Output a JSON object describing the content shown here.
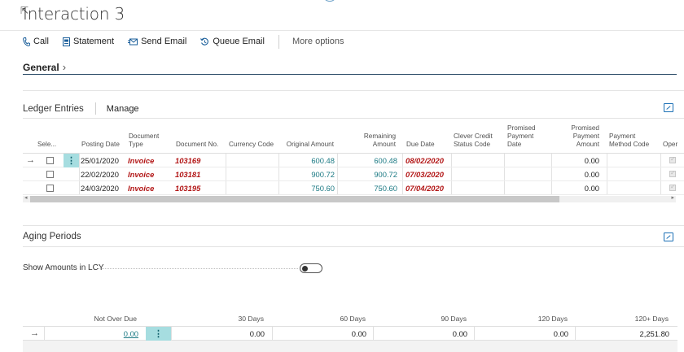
{
  "page": {
    "title": "Interaction 3"
  },
  "actions": [
    {
      "label": "Call",
      "icon": "phone-icon"
    },
    {
      "label": "Statement",
      "icon": "statement-icon"
    },
    {
      "label": "Send Email",
      "icon": "email-icon"
    },
    {
      "label": "Queue Email",
      "icon": "queue-icon"
    }
  ],
  "more_options": "More options",
  "general": {
    "label": "General",
    "chevron": "›"
  },
  "ledger": {
    "title": "Ledger Entries",
    "manage": "Manage",
    "columns": [
      "Sele...",
      "Posting Date",
      "Document Type",
      "Document No.",
      "Currency Code",
      "Original Amount",
      "Remaining Amount",
      "Due Date",
      "Clever Credit Status Code",
      "Promised Payment Date",
      "Promised Payment Amount",
      "Payment Method Code",
      "Oper"
    ],
    "rows": [
      {
        "posting_date": "25/01/2020",
        "doc_type": "Invoice",
        "doc_no": "103169",
        "currency": "",
        "original": "600.48",
        "remaining": "600.48",
        "due_date": "08/02/2020",
        "status": "",
        "promised_date": "",
        "promised_amount": "0.00",
        "method": ""
      },
      {
        "posting_date": "22/02/2020",
        "doc_type": "Invoice",
        "doc_no": "103181",
        "currency": "",
        "original": "900.72",
        "remaining": "900.72",
        "due_date": "07/03/2020",
        "status": "",
        "promised_date": "",
        "promised_amount": "0.00",
        "method": ""
      },
      {
        "posting_date": "24/03/2020",
        "doc_type": "Invoice",
        "doc_no": "103195",
        "currency": "",
        "original": "750.60",
        "remaining": "750.60",
        "due_date": "07/04/2020",
        "status": "",
        "promised_date": "",
        "promised_amount": "0.00",
        "method": ""
      }
    ]
  },
  "aging": {
    "title": "Aging Periods",
    "show_lcy_label": "Show Amounts in LCY",
    "show_lcy": false,
    "headers": [
      "Not Over Due",
      "30 Days",
      "60 Days",
      "90 Days",
      "120 Days",
      "120+ Days"
    ],
    "values": [
      "0.00",
      "0.00",
      "0.00",
      "0.00",
      "0.00",
      "2,251.80"
    ]
  },
  "colors": {
    "accent": "#1a6fb5",
    "link": "#1c7a84",
    "overdue": "#b21515",
    "selected": "#a6dde0"
  }
}
